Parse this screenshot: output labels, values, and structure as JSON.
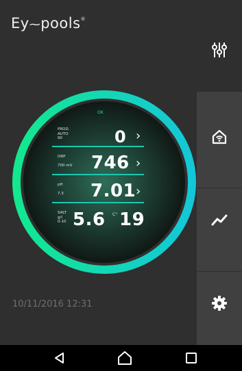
{
  "app": {
    "logo_left": "Ey",
    "logo_dash": "⁓",
    "logo_right": "pools",
    "logo_mark": "®"
  },
  "dial": {
    "status": "OK",
    "prod": {
      "label1": "PROD.",
      "label2": "AUTO",
      "label3": "90",
      "value": "0"
    },
    "orp": {
      "label1": "ORP",
      "label2": "700 mV",
      "value": "746"
    },
    "ph": {
      "label1": "pH",
      "label2": "7.3",
      "value": "7.01"
    },
    "salt": {
      "label1": "SALT",
      "label2": "g/l",
      "label3": "0-10",
      "value": "5.6",
      "temp_unit": "C°",
      "temp_value": "19"
    },
    "chevron": "›"
  },
  "timestamp": "10/11/2016 12:31",
  "colors": {
    "accent": "#19e0a5",
    "ring_start": "#13e88f",
    "ring_end": "#14c7d8",
    "sidebar": "#404040",
    "background": "#2f2f2f"
  },
  "icons": [
    "sliders-icon",
    "home-wifi-icon",
    "trend-chart-icon",
    "gear-icon",
    "back-icon",
    "home-icon",
    "recents-icon"
  ]
}
